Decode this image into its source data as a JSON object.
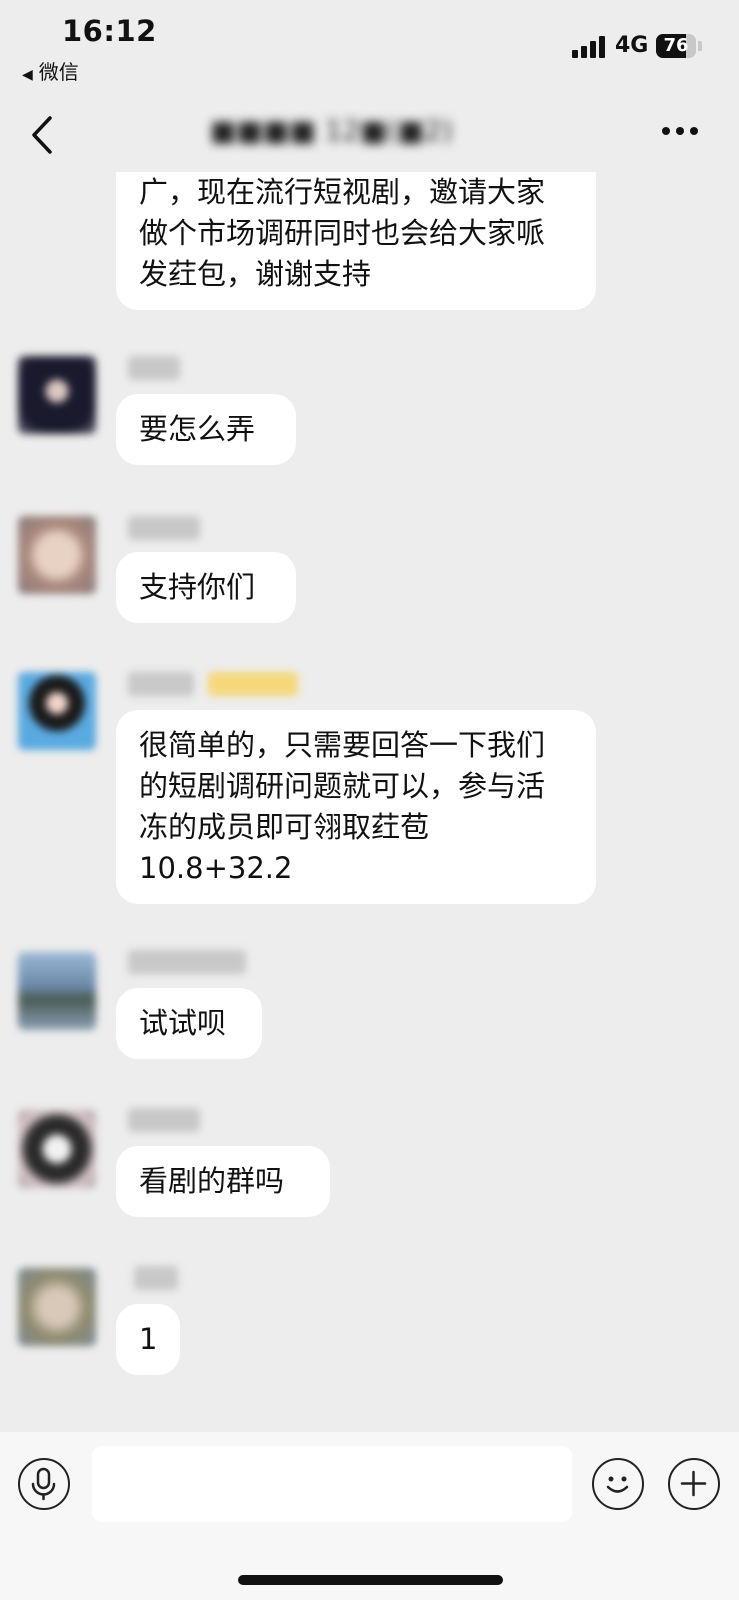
{
  "status_bar": {
    "time": "16:12",
    "back_app": "微信",
    "network": "4G",
    "battery": "76",
    "battery_level": 0.76
  },
  "nav": {
    "title": "■■■■ 12■(■2)",
    "back_icon": "chevron-left-icon",
    "more_icon": "more-dots-icon"
  },
  "messages": [
    {
      "text": "广，现在流行短视剧，邀请大家做个市场调研同时也会给大家哌发荭包，谢谢支持"
    },
    {
      "text": "要怎么弄"
    },
    {
      "text": "支持你们"
    },
    {
      "text": "很简单的，只需要回答一下我们的短剧调研问题就可以，参与活冻的成员即可翎取荭苞10.8+32.2"
    },
    {
      "text": "试试呗"
    },
    {
      "text": "看剧的群吗"
    },
    {
      "text": "1"
    }
  ],
  "input_bar": {
    "voice_icon": "voice-icon",
    "emoji_icon": "emoji-icon",
    "plus_icon": "plus-icon",
    "input_value": ""
  },
  "colors": {
    "background": "#ededed",
    "bubble": "#ffffff",
    "input_bar": "#f7f7f7"
  }
}
